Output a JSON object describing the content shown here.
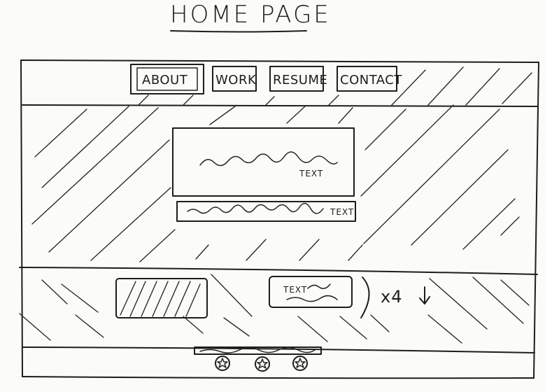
{
  "page_title": "HOME PAGE",
  "nav": {
    "items": [
      {
        "label": "ABOUT"
      },
      {
        "label": "WORK"
      },
      {
        "label": "RESUME"
      },
      {
        "label": "CONTACT"
      }
    ]
  },
  "hero": {
    "box_label": "TEXT",
    "caption_label": "TEXT"
  },
  "features": {
    "card_label": "TEXT",
    "repeat_label": "x4"
  },
  "footer": {
    "icon": "star-icon"
  }
}
